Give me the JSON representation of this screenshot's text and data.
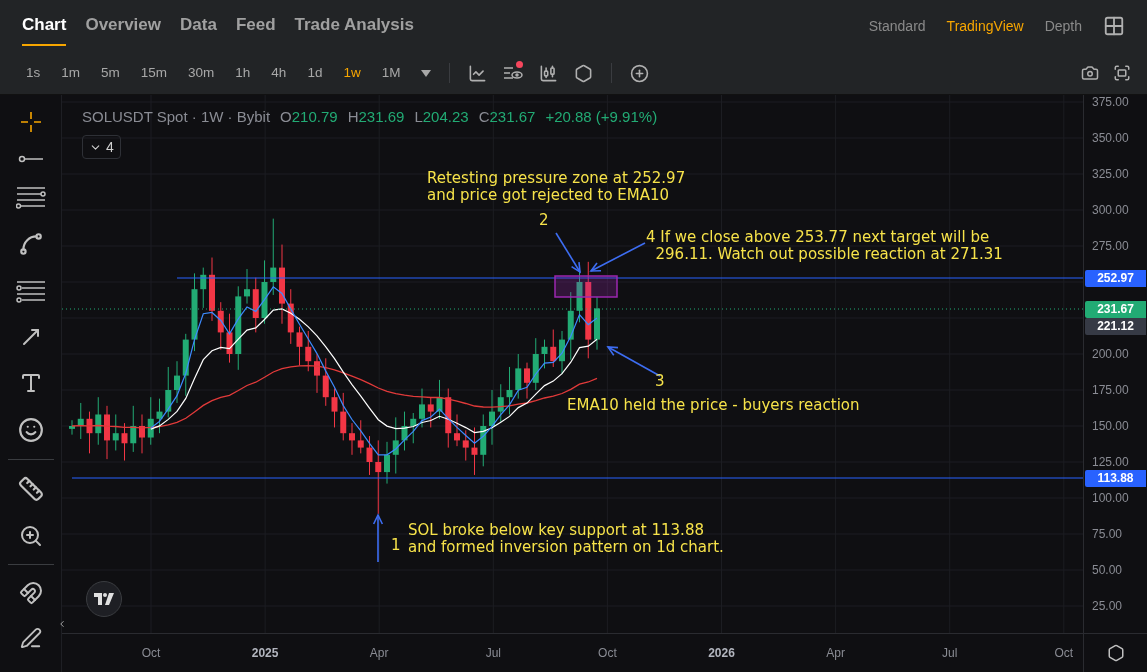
{
  "tabs": [
    {
      "label": "Chart",
      "selected": true
    },
    {
      "label": "Overview",
      "selected": false
    },
    {
      "label": "Data",
      "selected": false
    },
    {
      "label": "Feed",
      "selected": false
    },
    {
      "label": "Trade Analysis",
      "selected": false
    }
  ],
  "view_modes": [
    {
      "label": "Standard",
      "selected": false
    },
    {
      "label": "TradingView",
      "selected": true
    },
    {
      "label": "Depth",
      "selected": false
    }
  ],
  "intervals": [
    {
      "label": "1s",
      "selected": false
    },
    {
      "label": "1m",
      "selected": false
    },
    {
      "label": "5m",
      "selected": false
    },
    {
      "label": "15m",
      "selected": false
    },
    {
      "label": "30m",
      "selected": false
    },
    {
      "label": "1h",
      "selected": false
    },
    {
      "label": "4h",
      "selected": false
    },
    {
      "label": "1d",
      "selected": false
    },
    {
      "label": "1w",
      "selected": true
    },
    {
      "label": "1M",
      "selected": false
    }
  ],
  "indicators_alert": true,
  "legend": {
    "title": "SOLUSDT Spot · 1W · Bybit",
    "ohlc": [
      {
        "key": "O",
        "value": "210.79"
      },
      {
        "key": "H",
        "value": "231.69"
      },
      {
        "key": "L",
        "value": "204.23"
      },
      {
        "key": "C",
        "value": "231.67"
      }
    ],
    "change": "+20.88 (+9.91%)",
    "collapse_count": "4"
  },
  "annotations": [
    {
      "text": "Retesting pressure zone at 252.97\nand price got rejected to EMA10"
    },
    {
      "text": "2"
    },
    {
      "text": "4 If we close above 253.77 next target will be\n  296.11. Watch out possible reaction at 271.31"
    },
    {
      "text": "3"
    },
    {
      "text": "EMA10 held the price - buyers reaction"
    },
    {
      "text": "1"
    },
    {
      "text": "SOL broke below key support at 113.88\nand formed inversion pattern on 1d chart."
    }
  ],
  "price_axis": [
    "375.00",
    "350.00",
    "325.00",
    "300.00",
    "275.00",
    "200.00",
    "175.00",
    "150.00",
    "125.00",
    "100.00",
    "75.00",
    "50.00",
    "25.00"
  ],
  "price_tags": [
    {
      "value": "252.97",
      "color": "#2962ff"
    },
    {
      "value": "231.67",
      "color": "#22ab74"
    },
    {
      "value": "221.12",
      "color": "#363a45"
    },
    {
      "value": "113.88",
      "color": "#2962ff"
    }
  ],
  "time_axis": [
    {
      "label": "Oct",
      "major": false
    },
    {
      "label": "2025",
      "major": true
    },
    {
      "label": "Apr",
      "major": false
    },
    {
      "label": "Jul",
      "major": false
    },
    {
      "label": "Oct",
      "major": false
    },
    {
      "label": "2026",
      "major": true
    },
    {
      "label": "Apr",
      "major": false
    },
    {
      "label": "Jul",
      "major": false
    },
    {
      "label": "Oct",
      "major": false
    }
  ]
}
